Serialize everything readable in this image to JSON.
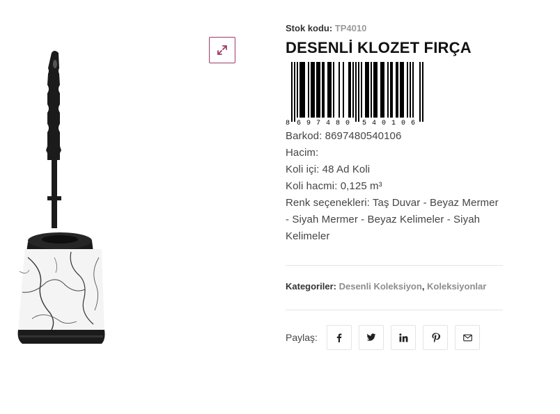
{
  "product": {
    "sku_label": "Stok kodu:",
    "sku_value": "TP4010",
    "title": "DESENLİ KLOZET FIRÇA",
    "barcode_digits": [
      "8",
      "6",
      "9",
      "7",
      "4",
      "8",
      "0",
      "5",
      "4",
      "0",
      "1",
      "0",
      "6"
    ],
    "attributes": {
      "barkod": "Barkod: 8697480540106",
      "hacim": "Hacim:",
      "koli_ici": "Koli içi: 48 Ad Koli",
      "koli_hacmi": "Koli hacmi: 0,125 m³",
      "renk": "Renk seçenekleri: Taş Duvar - Beyaz Mermer - Siyah Mermer - Beyaz Kelimeler - Siyah Kelimeler"
    }
  },
  "categories": {
    "label": "Kategoriler:",
    "items": [
      "Desenli Koleksiyon",
      "Koleksiyonlar"
    ],
    "separator": ", "
  },
  "share": {
    "label": "Paylaş:",
    "icons": [
      "facebook-icon",
      "twitter-icon",
      "linkedin-icon",
      "pinterest-icon",
      "email-icon"
    ]
  },
  "colors": {
    "accent": "#9b3a6a",
    "text": "#333333",
    "muted": "#9a9a9a",
    "divider": "#e5e5e5"
  }
}
